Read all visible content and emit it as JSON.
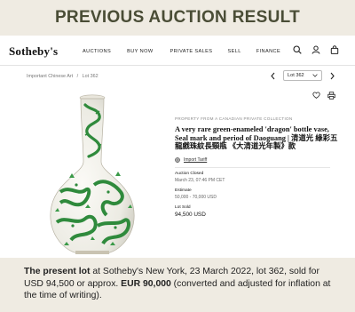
{
  "banner": {
    "heading": "PREVIOUS AUCTION RESULT"
  },
  "nav": {
    "logo": "Sotheby's",
    "links": [
      "AUCTIONS",
      "BUY NOW",
      "PRIVATE SALES",
      "SELL",
      "FINANCE"
    ]
  },
  "breadcrumb": {
    "parent": "Important Chinese Art",
    "separator": "/",
    "current": "Lot 362"
  },
  "lot_selector": {
    "value": "Lot 362"
  },
  "lot": {
    "provenance": "PROPERTY FROM A CANADIAN PRIVATE COLLECTION",
    "title": "A very rare green-enameled 'dragon' bottle vase, Seal mark and period of Daoguang | 清道光 綠彩五龍戲珠紋長頸瓶 《大清道光年製》款",
    "import_tariff": "Import Tariff",
    "closed_label": "Auction Closed",
    "closed_value": "March 23, 07:46 PM CET",
    "estimate_label": "Estimate",
    "estimate_value": "50,000 - 70,000 USD",
    "sold_label": "Lot Sold",
    "sold_value": "94,500 USD"
  },
  "caption": {
    "lead": "The present lot",
    "text1": " at Sotheby's New York, 23 March 2022, lot 362, sold for USD 94,500 or approx. ",
    "eur": "EUR 90,000",
    "text2": " (converted and adjusted for inflation at the time of writing)."
  },
  "colors": {
    "banner_text": "#4a4d36",
    "background": "#efebe2",
    "dragon_green": "#2f8a3c"
  },
  "icons": [
    "search-icon",
    "user-icon",
    "bag-icon",
    "chevron-left-icon",
    "chevron-right-icon",
    "heart-icon",
    "print-icon",
    "globe-icon"
  ]
}
